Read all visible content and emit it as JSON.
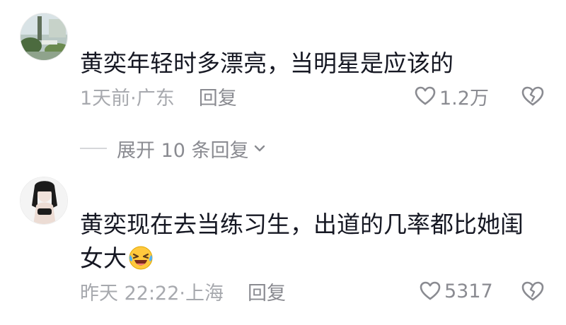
{
  "comments": [
    {
      "text": "黄奕年轻时多漂亮，当明星是应该的",
      "time_location": "1天前·广东",
      "reply_label": "回复",
      "likes": "1.2万"
    },
    {
      "text": "黄奕现在去当练习生，出道的几率都比她闺女大",
      "time_location": "昨天 22:22·上海",
      "reply_label": "回复",
      "likes": "5317",
      "emoji": "laughing-crying-emoji"
    }
  ],
  "expand_replies_label": "展开 10 条回复",
  "icons": [
    "heart-outline-icon",
    "broken-heart-icon",
    "chevron-down-icon"
  ],
  "colors": {
    "text": "#161823",
    "meta": "#a7a9ae",
    "secondary": "#8a8b91"
  }
}
